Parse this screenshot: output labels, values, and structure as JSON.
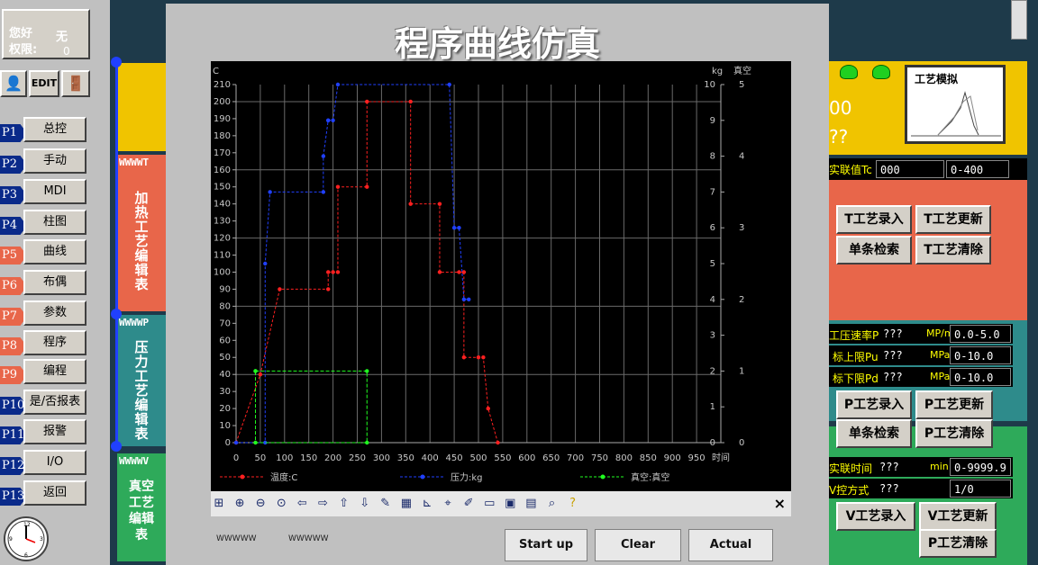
{
  "user": {
    "greeting": "您好",
    "greeting_value": "无",
    "permission_label": "权限:",
    "permission_value": "0"
  },
  "toolbar": {
    "edit_label": "EDIT"
  },
  "nav": [
    {
      "tag": "P1",
      "label": "总控",
      "color": "blue"
    },
    {
      "tag": "P2",
      "label": "手动",
      "color": "blue"
    },
    {
      "tag": "P3",
      "label": "MDI",
      "color": "blue"
    },
    {
      "tag": "P4",
      "label": "柱图",
      "color": "blue"
    },
    {
      "tag": "P5",
      "label": "曲线",
      "color": "red"
    },
    {
      "tag": "P6",
      "label": "布偶",
      "color": "red"
    },
    {
      "tag": "P7",
      "label": "参数",
      "color": "red"
    },
    {
      "tag": "P8",
      "label": "程序",
      "color": "red"
    },
    {
      "tag": "P9",
      "label": "编程",
      "color": "red"
    },
    {
      "tag": "P10",
      "label": "是/否报表",
      "color": "blue"
    },
    {
      "tag": "P11",
      "label": "报警",
      "color": "blue"
    },
    {
      "tag": "P12",
      "label": "I/O",
      "color": "blue"
    },
    {
      "tag": "P13",
      "label": "返回",
      "color": "blue"
    }
  ],
  "sections": {
    "heat": {
      "code": "WWWWT",
      "label": "加热工艺编辑表",
      "color": "#e8664a"
    },
    "pressure": {
      "code": "WWWWP",
      "label": "压力工艺编辑表",
      "color": "#2e8b8b"
    },
    "vacuum": {
      "code": "WWWWV",
      "label": "真空工艺编辑表",
      "color": "#2eaa5a"
    }
  },
  "window": {
    "title": "程序曲线仿真"
  },
  "chart_data": {
    "type": "line",
    "x_label": "时间",
    "x_ticks": [
      "0",
      "50",
      "100",
      "150",
      "200",
      "250",
      "300",
      "350",
      "400",
      "450",
      "500",
      "550",
      "600",
      "650",
      "700",
      "750",
      "800",
      "850",
      "900",
      "950",
      "时间"
    ],
    "xlim": [
      0,
      1000
    ],
    "left_axis": {
      "unit": "C",
      "ylim": [
        0,
        210
      ],
      "ticks": [
        "0",
        "10",
        "20",
        "30",
        "40",
        "50",
        "60",
        "70",
        "80",
        "90",
        "100",
        "110",
        "120",
        "130",
        "140",
        "150",
        "160",
        "170",
        "180",
        "190",
        "200",
        "210"
      ]
    },
    "right_axis_1": {
      "unit": "kg",
      "ylim": [
        0,
        10
      ],
      "ticks": [
        "0",
        "1",
        "2",
        "3",
        "4",
        "5",
        "6",
        "7",
        "8",
        "9",
        "10"
      ]
    },
    "right_axis_2": {
      "unit": "真空",
      "ylim": [
        0,
        5
      ],
      "ticks": [
        "0",
        "1",
        "2",
        "3",
        "4",
        "5"
      ]
    },
    "grid": true,
    "legend_position": "bottom",
    "series": [
      {
        "name": "温度:C",
        "color": "#ff2020",
        "axis": "left",
        "points": [
          [
            0,
            0
          ],
          [
            50,
            40
          ],
          [
            90,
            90
          ],
          [
            190,
            90
          ],
          [
            190,
            100
          ],
          [
            200,
            100
          ],
          [
            210,
            100
          ],
          [
            210,
            150
          ],
          [
            270,
            150
          ],
          [
            270,
            200
          ],
          [
            360,
            200
          ],
          [
            360,
            140
          ],
          [
            420,
            140
          ],
          [
            420,
            100
          ],
          [
            460,
            100
          ],
          [
            470,
            100
          ],
          [
            470,
            50
          ],
          [
            500,
            50
          ],
          [
            510,
            50
          ],
          [
            520,
            20
          ],
          [
            540,
            0
          ]
        ]
      },
      {
        "name": "压力:kg",
        "color": "#2040ff",
        "axis": "right1",
        "points": [
          [
            0,
            0
          ],
          [
            60,
            0
          ],
          [
            60,
            5
          ],
          [
            70,
            7
          ],
          [
            180,
            7
          ],
          [
            180,
            8
          ],
          [
            190,
            9
          ],
          [
            190,
            9
          ],
          [
            200,
            9
          ],
          [
            210,
            10
          ],
          [
            440,
            10
          ],
          [
            450,
            6
          ],
          [
            460,
            6
          ],
          [
            470,
            4
          ],
          [
            480,
            4
          ]
        ]
      },
      {
        "name": "真空:真空",
        "color": "#20ff20",
        "axis": "right2",
        "points": [
          [
            40,
            1
          ],
          [
            270,
            1
          ],
          [
            270,
            0
          ],
          [
            40,
            0
          ],
          [
            40,
            1
          ]
        ]
      }
    ]
  },
  "chart_toolbar": {
    "close_icon": "×"
  },
  "bottom": {
    "small1": "WWWWW",
    "small2": "WWWWW",
    "start": "Start up",
    "clear": "Clear",
    "actual": "Actual"
  },
  "right": {
    "thumb_title": "工艺模拟",
    "partial_top1": "00",
    "partial_top2": "??",
    "tc_label": "实联值Tc",
    "tc_value": "000",
    "tc_range": "0-400",
    "t_btns": [
      "T工艺录入",
      "T工艺更新",
      "单条检索",
      "T工艺清除"
    ],
    "p_rows": [
      {
        "label": "工压速率PF",
        "value": "???",
        "unit": "MP/m",
        "range": "0.0-5.0"
      },
      {
        "label": "标上限Pu",
        "value": "???",
        "unit": "MPa",
        "range": "0-10.0"
      },
      {
        "label": "标下限Pd",
        "value": "???",
        "unit": "MPa",
        "range": "0-10.0"
      }
    ],
    "p_btns": [
      "P工艺录入",
      "P工艺更新",
      "单条检索",
      "P工艺清除"
    ],
    "v_rows": [
      {
        "label": "实联时间",
        "value": "???",
        "unit": "min",
        "range": "0-9999.9"
      },
      {
        "label": "V控方式",
        "value": "???",
        "unit": "",
        "range": "1/0"
      }
    ],
    "v_btns": [
      "V工艺录入",
      "V工艺更新",
      "P工艺清除"
    ]
  }
}
